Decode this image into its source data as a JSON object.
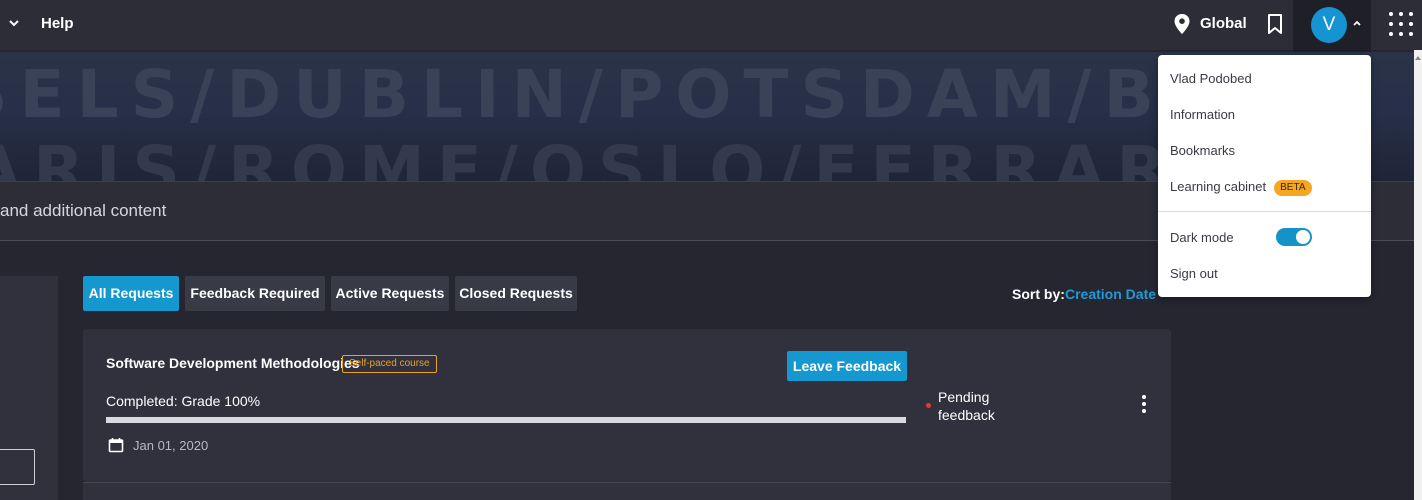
{
  "topbar": {
    "help_label": "Help",
    "location_label": "Global",
    "avatar_initial": "V"
  },
  "banner": {
    "line1": "SELS/DUBLIN/POTSDAM/BRUS",
    "line2": "ARIS/ROME/OSLO/FERRARA/"
  },
  "subheader": {
    "text": "and additional content"
  },
  "tabs": [
    {
      "label": "All Requests",
      "active": true
    },
    {
      "label": "Feedback Required",
      "active": false
    },
    {
      "label": "Active Requests",
      "active": false
    },
    {
      "label": "Closed Requests",
      "active": false
    }
  ],
  "sort": {
    "label": "Sort by:",
    "value": "Creation Date"
  },
  "request_card": {
    "title": "Software Development Methodologies",
    "badge": "Self-paced course",
    "button_label": "Leave Feedback",
    "grade_text": "Completed: Grade 100%",
    "progress_percent": 100,
    "date": "Jan 01, 2020",
    "status": "Pending feedback",
    "status_color": "#e53935"
  },
  "user_menu": {
    "user_name": "Vlad Podobed",
    "items": [
      {
        "label": "Information"
      },
      {
        "label": "Bookmarks"
      },
      {
        "label": "Learning cabinet",
        "badge": "BETA"
      }
    ],
    "dark_mode_label": "Dark mode",
    "dark_mode_on": true,
    "sign_out_label": "Sign out"
  },
  "colors": {
    "accent": "#1597d0",
    "background": "#262631",
    "beta_badge": "#f5a623"
  }
}
